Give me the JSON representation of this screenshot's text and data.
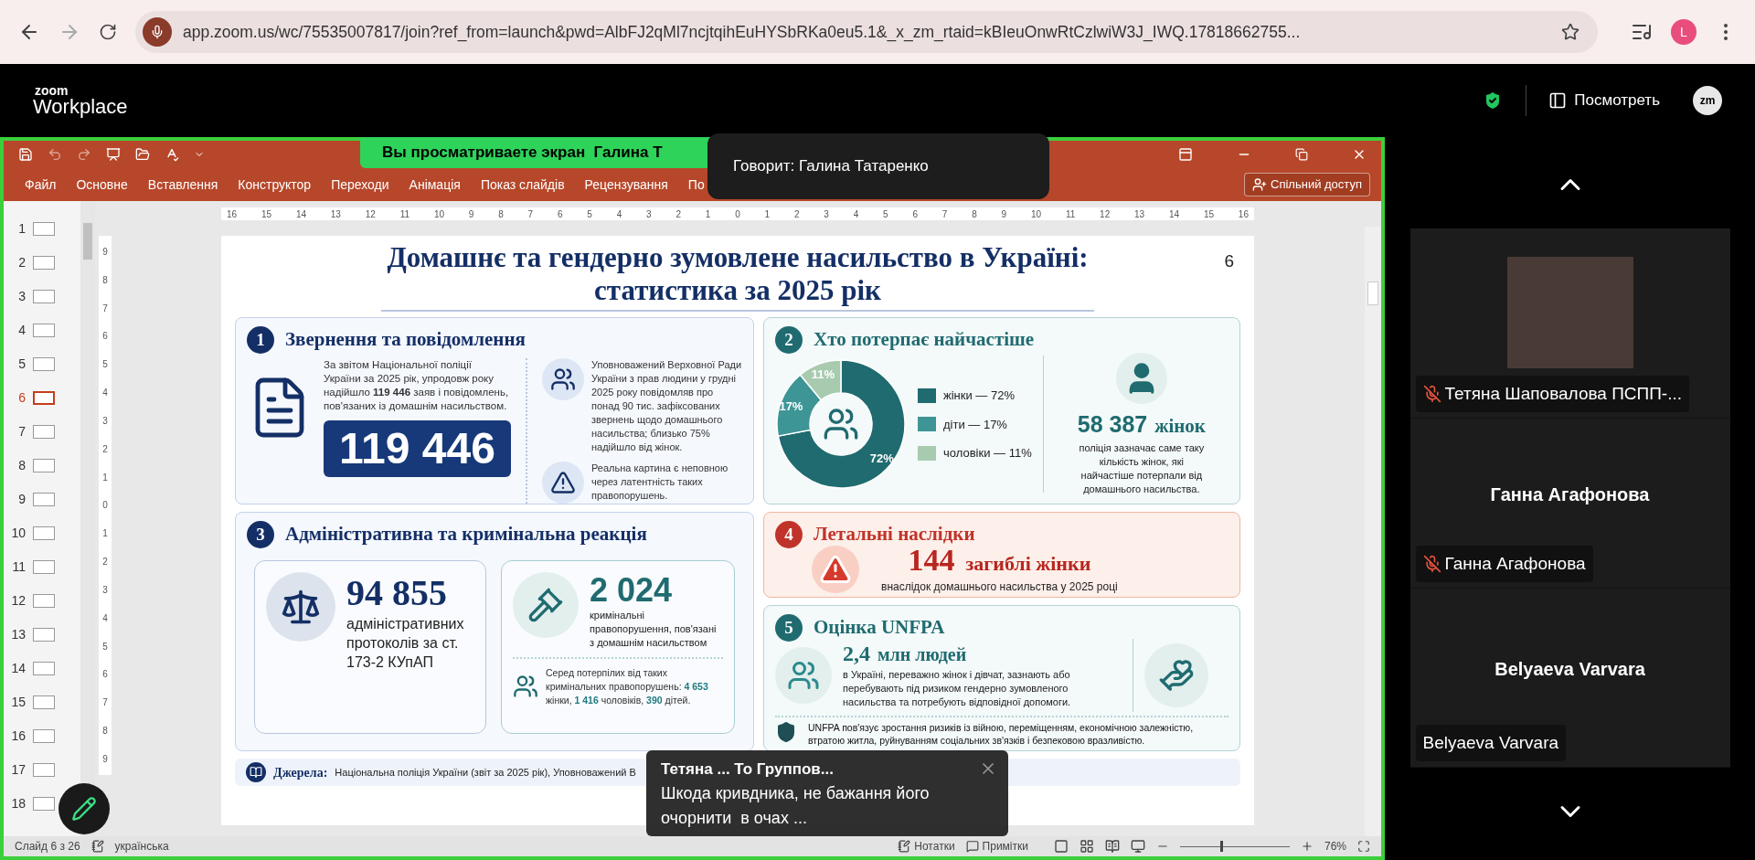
{
  "browser": {
    "url": "app.zoom.us/wc/75535007817/join?ref_from=launch&pwd=AlbFJ2qMl7ncjtqihEuHYSbRKa0eu5.1&_x_zm_rtaid=kBIeuOnwRtCzlwiW3J_IWQ.17818662755...",
    "profile_initial": "L"
  },
  "zoom_header": {
    "logo_top": "zoom",
    "logo_bottom": "Workplace",
    "view_button": "Посмотреть",
    "app_badge": "zm"
  },
  "share_banner": "Вы просматриваете экран  Галина Т",
  "speaker_popup": "Говорит: Галина Татаренко",
  "powerpoint": {
    "ribbon_tabs": [
      "Файл",
      "Основне",
      "Вставлення",
      "Конструктор",
      "Переходи",
      "Анімація",
      "Показ слайдів",
      "Рецензування",
      "По"
    ],
    "share_button": "Спільний доступ",
    "ruler_marks": [
      "16",
      "15",
      "14",
      "13",
      "12",
      "11",
      "10",
      "9",
      "8",
      "7",
      "6",
      "5",
      "4",
      "3",
      "2",
      "1",
      "0",
      "1",
      "2",
      "3",
      "4",
      "5",
      "6",
      "7",
      "8",
      "9",
      "10",
      "11",
      "12",
      "13",
      "14",
      "15",
      "16"
    ],
    "vertical_ruler_marks": [
      "9",
      "8",
      "7",
      "6",
      "5",
      "4",
      "3",
      "2",
      "1",
      "0",
      "1",
      "2",
      "3",
      "4",
      "5",
      "6",
      "7",
      "8",
      "9"
    ],
    "thumbnails": [
      {
        "number": "1",
        "selected": false
      },
      {
        "number": "2",
        "selected": false
      },
      {
        "number": "3",
        "selected": false
      },
      {
        "number": "4",
        "selected": false
      },
      {
        "number": "5",
        "selected": false
      },
      {
        "number": "6",
        "selected": true
      },
      {
        "number": "7",
        "selected": false
      },
      {
        "number": "8",
        "selected": false
      },
      {
        "number": "9",
        "selected": false
      },
      {
        "number": "10",
        "selected": false
      },
      {
        "number": "11",
        "selected": false
      },
      {
        "number": "12",
        "selected": false
      },
      {
        "number": "13",
        "selected": false
      },
      {
        "number": "14",
        "selected": false
      },
      {
        "number": "15",
        "selected": false
      },
      {
        "number": "16",
        "selected": false
      },
      {
        "number": "17",
        "selected": false
      },
      {
        "number": "18",
        "selected": false
      }
    ],
    "status": {
      "slide": "Слайд 6 з 26",
      "language": "українська",
      "notes": "Нотатки",
      "comments": "Примітки",
      "zoom": "76%",
      "zoom_slider": {
        "level": 0.37
      }
    }
  },
  "slide": {
    "title_lines": [
      "Домашнє та гендерно зумовлене насильство в Україні:",
      "статистика за 2025 рік"
    ],
    "page_number": "6",
    "panel_1": {
      "number": "1",
      "title": "Звернення та повідомлення",
      "text": "За звітом Національної поліції України за 2025 рік, упродовж року надійшло **119 446** заяв і повідомлень, пов'язаних із домашнім насильством.",
      "big_number": "119 446",
      "ombudsman_text": "Уповноважений Верховної Ради України з прав людини у грудні 2025 року повідомляв про понад 90 тис. зафіксованих звернень щодо домашнього насильства; близько 75% надійшло від жінок.",
      "warning_text": "Реальна картина є неповною через латентність таких правопорушень."
    },
    "panel_2": {
      "number": "2",
      "title": "Хто потерпає найчастіше",
      "chart_data": {
        "type": "donut",
        "categories": [
          "жінки — 72%",
          "діти — 17%",
          "чоловіки — 11%"
        ],
        "values": [
          72,
          17,
          11
        ],
        "value_labels": [
          "72%",
          "17%",
          "11%"
        ]
      },
      "legend": [
        {
          "color": "#1f6b70"
        },
        {
          "color": "#3e9596"
        },
        {
          "color": "#a8cbb0"
        }
      ],
      "stat_value": "58 387",
      "stat_unit": "жінок",
      "stat_caption": "поліція зазначає саме таку кількість жінок, які найчастіше потерпали від домашнього насильства."
    },
    "panel_3": {
      "number": "3",
      "title": "Адміністративна та кримінальна реакція",
      "admin_value": "94 855",
      "admin_caption": "адміністративних протоколів за ст. 173-2 КУпАП",
      "criminal_value": "2 024",
      "criminal_caption": "кримінальні правопорушення, пов'язані з домашнім насильством",
      "victims_text": "Серед потерпілих від таких кримінальних правопорушень: **4 653** жінки, **1 416** чоловіків, **390** дітей."
    },
    "panel_4": {
      "number": "4",
      "title": "Летальні наслідки",
      "stat_value": "144",
      "stat_unit": "загиблі жінки",
      "caption": "внаслідок домашнього насильства у 2025 році"
    },
    "panel_5": {
      "number": "5",
      "title": "Оцінка UNFPA",
      "stat_value": "2,4",
      "stat_unit": "млн людей",
      "text": "в Україні, переважно жінок і дівчат, зазнають або перебувають під ризиком гендерно зумовленого насильства та потребують відповідної допомоги.",
      "note": "UNFPA пов'язує зростання ризиків із війною, переміщенням, економічною залежністю, втратою житла, руйнуванням соціальних зв'язків і безпековою вразливістю."
    },
    "sources": {
      "label": "Джерела:",
      "text": "Національна поліція України (звіт за 2025 рік), Уповноважений В"
    }
  },
  "participants": [
    {
      "kind": "video",
      "label": "Тетяна Шаповалова ПСПП-...",
      "muted": true
    },
    {
      "kind": "name",
      "center_name": "Ганна Агафонова",
      "label": "Ганна Агафонова",
      "muted": true
    },
    {
      "kind": "name",
      "center_name": "Belyaeva Varvara",
      "label": "Belyaeva Varvara",
      "muted": false
    }
  ],
  "chat_toast": {
    "sender": "Тетяна ... То Группов...",
    "message": "Шкода кривдника, не бажання його очорнити  в очах ..."
  }
}
